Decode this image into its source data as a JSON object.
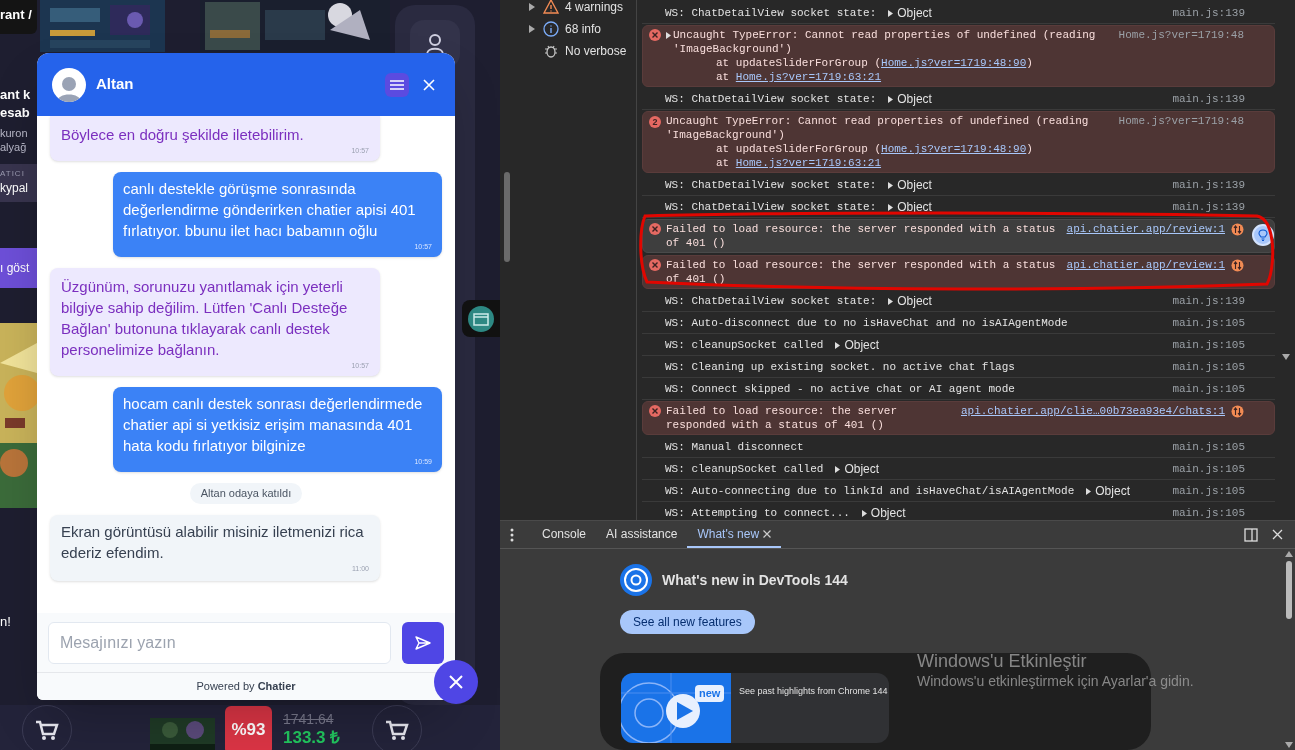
{
  "website": {
    "fragments": [
      {
        "kind": "tag",
        "text": "rant /"
      },
      {
        "kind": "title",
        "text": "ant k"
      },
      {
        "kind": "title",
        "text": "esab"
      },
      {
        "kind": "sub",
        "text": "kuron"
      },
      {
        "kind": "sub",
        "text": "alyağ"
      },
      {
        "kind": "caption",
        "text": "ATICI"
      },
      {
        "kind": "seller",
        "text": "kypal"
      },
      {
        "kind": "button",
        "text": "ı göst"
      },
      {
        "kind": "picture"
      },
      {
        "kind": "note",
        "text": "n!"
      }
    ],
    "product": {
      "discount": "%93",
      "old_price": "1741.64",
      "price": "133.3 ₺"
    }
  },
  "chat": {
    "agent_name": "Altan",
    "messages": [
      {
        "kind": "bot",
        "text": "Böylece en doğru şekilde iletebilirim.",
        "time": "10:57"
      },
      {
        "kind": "user",
        "text": "canlı destekle görüşme sonrasında değerlendirme gönderirken chatier apisi 401 fırlatıyor. bbunu ilet hacı babamın oğlu",
        "time": "10:57"
      },
      {
        "kind": "bot",
        "text": "Üzgünüm, sorunuzu yanıtlamak için yeterli bilgiye sahip değilim. Lütfen 'Canlı Desteğe Bağlan' butonuna tıklayarak canlı destek personelimize bağlanın.",
        "time": "10:57"
      },
      {
        "kind": "user",
        "text": "hocam canlı destek sonrası değerlendirmede chatier api si yetkisiz erişim manasında 401 hata kodu fırlatıyor bilginize",
        "time": "10:59"
      },
      {
        "kind": "system",
        "text": "Altan odaya katıldı"
      },
      {
        "kind": "agent",
        "text": "Ekran görüntüsü alabilir misiniz iletmenizi rica ederiz efendim.",
        "time": "11:00"
      }
    ],
    "input": {
      "placeholder": "Mesajınızı yazın"
    },
    "footer": "Powered by **Chatier**"
  },
  "devtools": {
    "sidebar": [
      {
        "kind": "warning",
        "label": "4 warnings"
      },
      {
        "kind": "info",
        "label": "68 info"
      },
      {
        "kind": "verbose",
        "label": "No verbose"
      }
    ],
    "console": [
      {
        "kind": "log",
        "text": "WS: ChatDetailView socket state:",
        "object": "Object",
        "source": "main.js:139"
      },
      {
        "kind": "error",
        "expandable": true,
        "text": "Uncaught TypeError: Cannot read properties of undefined (reading 'ImageBackground')",
        "stack": [
          {
            "prefix": "at updateSliderForGroup (",
            "link": "Home.js?ver=1719:48:90",
            "suffix": ")"
          },
          {
            "prefix": "at ",
            "link": "Home.js?ver=1719:63:21"
          }
        ],
        "source": "Home.js?ver=1719:48",
        "focused": false
      },
      {
        "kind": "log",
        "text": "WS: ChatDetailView socket state:",
        "object": "Object",
        "source": "main.js:139"
      },
      {
        "kind": "error",
        "expandable": false,
        "count": "2",
        "text": "Uncaught TypeError: Cannot read properties of undefined (reading 'ImageBackground')",
        "stack": [
          {
            "prefix": "at updateSliderForGroup (",
            "link": "Home.js?ver=1719:48:90",
            "suffix": ")"
          },
          {
            "prefix": "at ",
            "link": "Home.js?ver=1719:63:21"
          }
        ],
        "source": "Home.js?ver=1719:48",
        "focused": false
      },
      {
        "kind": "log",
        "text": "WS: ChatDetailView socket state:",
        "object": "Object",
        "source": "main.js:139"
      },
      {
        "kind": "log",
        "text": "WS: ChatDetailView socket state:",
        "object": "Object",
        "source": "main.js:139"
      },
      {
        "kind": "network",
        "text": "Failed to load resource: the server responded with a status of 401 ()",
        "link": "api.chatier.app/review:1",
        "focused": true,
        "insight": true
      },
      {
        "kind": "network",
        "text": "Failed to load resource: the server responded with a status of 401 ()",
        "link": "api.chatier.app/review:1",
        "focused": false,
        "insight": false
      },
      {
        "kind": "log",
        "text": "WS: ChatDetailView socket state:",
        "object": "Object",
        "source": "main.js:139"
      },
      {
        "kind": "log",
        "text": "WS: Auto-disconnect due to no isHaveChat and no isAIAgentMode",
        "source": "main.js:105"
      },
      {
        "kind": "log",
        "text": "WS: cleanupSocket called",
        "object": "Object",
        "source": "main.js:105"
      },
      {
        "kind": "log",
        "text": "WS: Cleaning up existing socket. no active chat flags",
        "source": "main.js:105"
      },
      {
        "kind": "log",
        "text": "WS: Connect skipped - no active chat or AI agent mode",
        "source": "main.js:105"
      },
      {
        "kind": "network",
        "text": "Failed to load resource: the server responded with a status of 401 ()",
        "link": "api.chatier.app/clie…00b73ea93e4/chats:1",
        "focused": false,
        "insight": false
      },
      {
        "kind": "log",
        "text": "WS: Manual disconnect",
        "source": "main.js:105"
      },
      {
        "kind": "log",
        "text": "WS: cleanupSocket called",
        "object": "Object",
        "source": "main.js:105"
      },
      {
        "kind": "log",
        "text": "WS: Auto-connecting due to linkId and isHaveChat/isAIAgentMode",
        "object": "Object",
        "source": "main.js:105"
      },
      {
        "kind": "log",
        "text": "WS: Attempting to connect...",
        "object": "Object",
        "source": "main.js:105"
      }
    ],
    "drawer": {
      "tabs": [
        {
          "label": "Console",
          "selected": false
        },
        {
          "label": "AI assistance",
          "selected": false
        },
        {
          "label": "What's new",
          "selected": true
        }
      ],
      "title": "What's new in DevTools 144",
      "button": "See all new features",
      "card": {
        "badge": "new",
        "text": "See past highlights from Chrome 144"
      }
    }
  },
  "os_notice": {
    "title": "Windows'u Etkinleştir",
    "text": "Windows'u etkinleştirmek için Ayarlar'a gidin."
  }
}
